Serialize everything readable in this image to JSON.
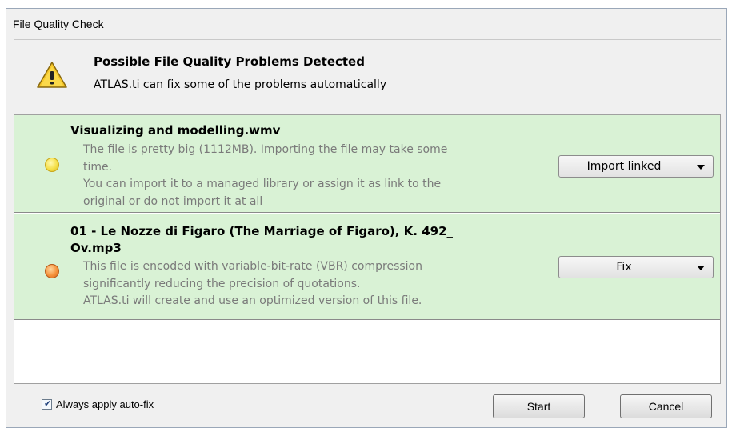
{
  "window": {
    "title": "File Quality Check"
  },
  "header": {
    "icon": "warning-icon",
    "title": "Possible File Quality Problems Detected",
    "subtitle": "ATLAS.ti can fix some of the problems automatically"
  },
  "items": [
    {
      "status_color": "#f5e04a",
      "status_icon": "yellow-status-dot",
      "title": "Visualizing and modelling.wmv",
      "desc_lines": [
        "The file is pretty big (1112MB). Importing the file may take some",
        "time.",
        "You can import it to a managed library or assign it as link to the",
        "original or do not import it at all"
      ],
      "action": "Import linked"
    },
    {
      "status_color": "#f5913a",
      "status_icon": "orange-status-dot",
      "title_lines": [
        "01 - Le Nozze di Figaro (The Marriage of Figaro), K. 492_",
        "Ov.mp3"
      ],
      "desc_lines": [
        "This file is encoded with variable-bit-rate (VBR) compression",
        "significantly reducing the precision of quotations.",
        "ATLAS.ti will create and use an optimized version of this file."
      ],
      "action": "Fix"
    }
  ],
  "footer": {
    "checkbox_label": "Always apply auto-fix",
    "checkbox_checked": true,
    "start_label": "Start",
    "cancel_label": "Cancel"
  },
  "colors": {
    "item_background": "#d9f2d5",
    "dialog_background": "#f0f0f0"
  }
}
